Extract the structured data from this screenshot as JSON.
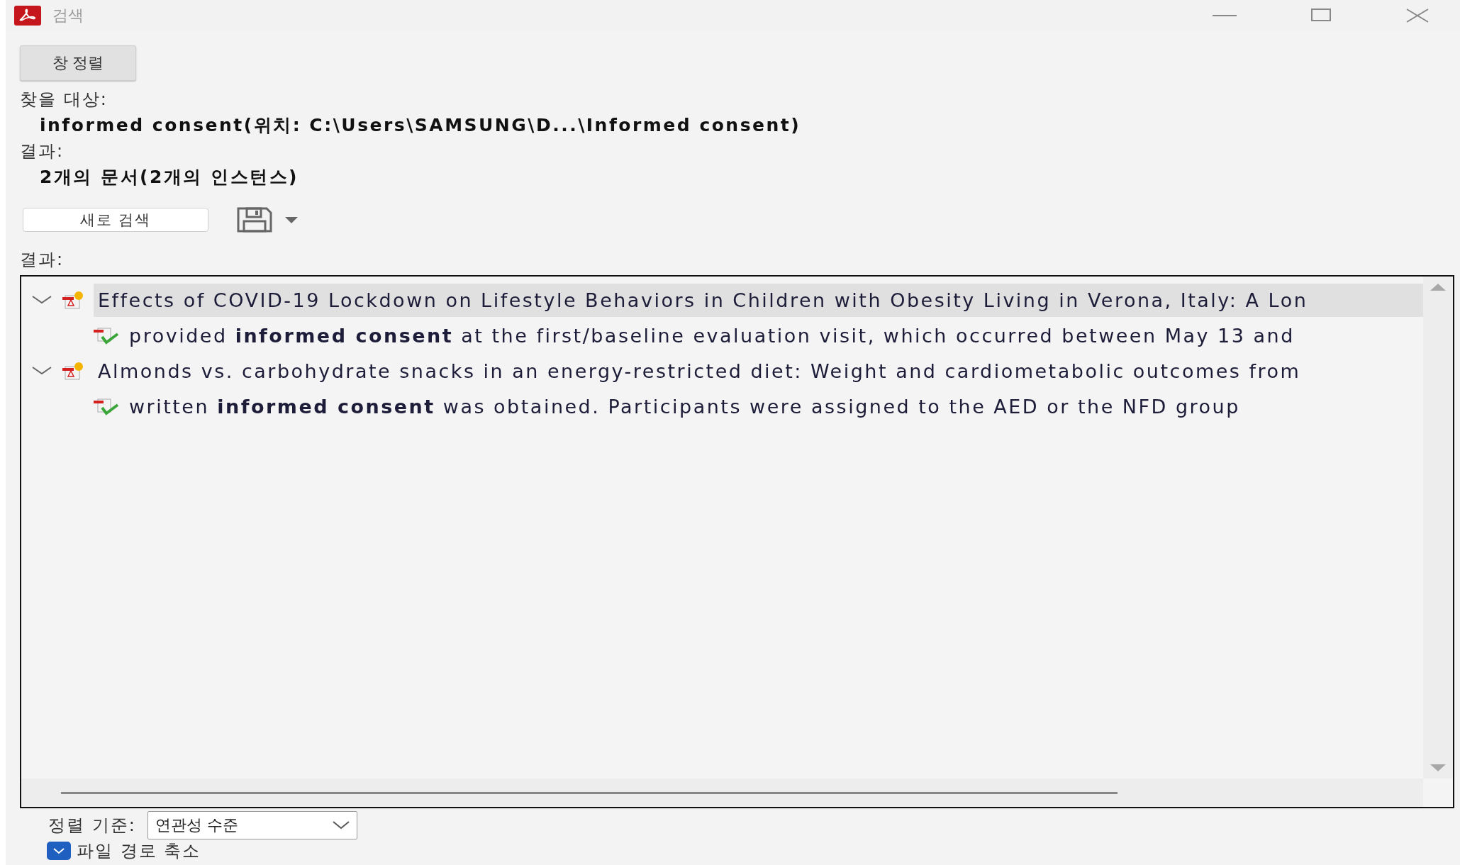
{
  "window": {
    "title": "검색"
  },
  "arrange_button": "창 정렬",
  "search_for": {
    "label": "찾을 대상:",
    "value": "informed consent(위치: C:\\Users\\SAMSUNG\\D...\\Informed consent)"
  },
  "summary": {
    "label": "결과:",
    "value": "2개의 문서(2개의 인스턴스)"
  },
  "new_search_button": "새로 검색",
  "results_label": "결과:",
  "results": [
    {
      "title": "Effects of COVID-19 Lockdown on Lifestyle Behaviors in Children with Obesity Living in Verona, Italy: A Lon",
      "expanded": true,
      "selected": true,
      "children": [
        {
          "text": "provided **informed consent** at the first/baseline evaluation visit, which occurred between May 13 and"
        }
      ]
    },
    {
      "title": "Almonds vs. carbohydrate snacks in an energy-restricted diet: Weight and cardiometabolic outcomes from",
      "expanded": true,
      "selected": false,
      "children": [
        {
          "text": "written **informed consent** was obtained. Participants were assigned to the AED or the NFD group"
        }
      ]
    }
  ],
  "sort": {
    "label": "정렬 기준:",
    "value": "연관성 수준"
  },
  "shorten_paths": {
    "label": "파일 경로 축소",
    "checked": true
  }
}
